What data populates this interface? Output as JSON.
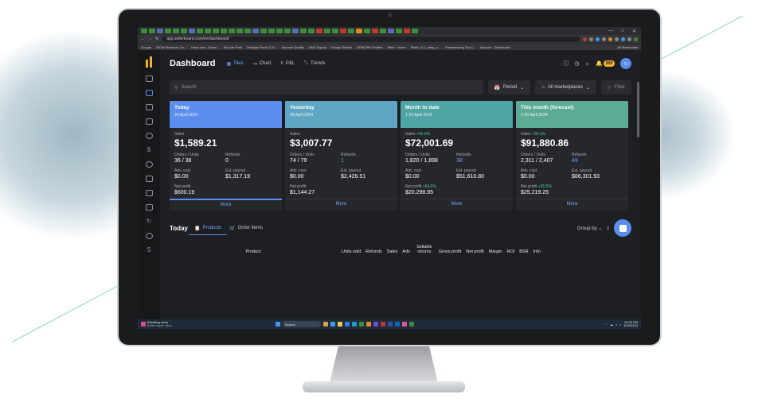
{
  "browser": {
    "url": "app.sellerboard.com/en/dashboard/",
    "bookmarks": [
      "Google",
      "TikTok Business Ce...",
      "Have new - Exam...",
      "My Job Feed",
      "Manage Feed 10 D...",
      "Account Quality",
      "AMZ Supply",
      "Google Sheets",
      "UPWORK Profiles",
      "Wise - Home",
      "Slack | 4-7_mktg_n...",
      "Paraphrasing Tool |...",
      "Account - Dashboard"
    ],
    "all_bookmarks": "All Bookmarks"
  },
  "header": {
    "title": "Dashboard",
    "tabs": [
      {
        "label": "Tiles",
        "icon": "grid-icon"
      },
      {
        "label": "Chart",
        "icon": "line-chart-icon"
      },
      {
        "label": "P&L",
        "icon": "list-icon"
      },
      {
        "label": "Trends",
        "icon": "trends-icon"
      }
    ],
    "notification_count": "209",
    "avatar_icon": "user-icon"
  },
  "filters": {
    "search_placeholder": "Search",
    "period_label": "Period",
    "marketplaces_label": "All marketplaces",
    "filter_label": "Filter"
  },
  "cards": [
    {
      "title": "Today",
      "date": "24 April 2024",
      "color": "#5b8def",
      "sales_label": "Sales",
      "sales_change": "",
      "sales": "$1,589.21",
      "orders_label": "Orders / Units",
      "orders": "36 / 38",
      "refunds_label": "Refunds",
      "refunds": "0",
      "adv_label": "Adv. cost",
      "adv": "$0.00",
      "payout_label": "Est. payout",
      "payout": "$1,317.19",
      "profit_label": "Net profit",
      "profit_change": "",
      "profit": "$600.19",
      "more": "More"
    },
    {
      "title": "Yesterday",
      "date": "23 April 2024",
      "color": "#5fa5c4",
      "sales_label": "Sales",
      "sales_change": "",
      "sales": "$3,007.77",
      "orders_label": "Orders / Units",
      "orders": "74 / 79",
      "refunds_label": "Refunds",
      "refunds": "1",
      "adv_label": "Adv. cost",
      "adv": "$0.00",
      "payout_label": "Est. payout",
      "payout": "$2,426.51",
      "profit_label": "Net profit",
      "profit_change": "",
      "profit": "$1,144.27",
      "more": "More"
    },
    {
      "title": "Month to date",
      "date": "1-24 April 2024",
      "color": "#4fa4a5",
      "sales_label": "Sales",
      "sales_change": "+45.0%",
      "sales": "$72,001.69",
      "orders_label": "Orders / Units",
      "orders": "1,820 / 1,898",
      "refunds_label": "Refunds",
      "refunds": "38",
      "adv_label": "Adv. cost",
      "adv": "$0.00",
      "payout_label": "Est. payout",
      "payout": "$51,610.80",
      "profit_label": "Net profit",
      "profit_change": "+54.0%",
      "profit": "$20,298.95",
      "more": "More"
    },
    {
      "title": "This month (forecast)",
      "date": "1-30 April 2024",
      "color": "#5cab96",
      "sales_label": "Sales",
      "sales_change": "+30.1%",
      "sales": "$91,880.86",
      "orders_label": "Orders / Units",
      "orders": "2,311 / 2,407",
      "refunds_label": "Refunds",
      "refunds": "49",
      "adv_label": "Adv. cost",
      "adv": "$0.00",
      "payout_label": "Est. payout",
      "payout": "$66,301.93",
      "profit_label": "Net profit",
      "profit_change": "+36.6%",
      "profit": "$25,219.25",
      "more": "More"
    }
  ],
  "bottom": {
    "period": "Today",
    "tabs": [
      "Products",
      "Order items"
    ],
    "group_by": "Group by"
  },
  "table": {
    "columns": [
      "Product",
      "Units sold",
      "Refunds",
      "Sales",
      "Ads",
      "Sellable returns",
      "Gross profit",
      "Net profit",
      "Margin",
      "ROI",
      "BSR",
      "Info"
    ]
  },
  "taskbar": {
    "news_title": "Breaking news",
    "news_sub": "Biden signs Ukra...",
    "search": "Search",
    "time": "12:30 PM",
    "date": "4/24/2024"
  }
}
